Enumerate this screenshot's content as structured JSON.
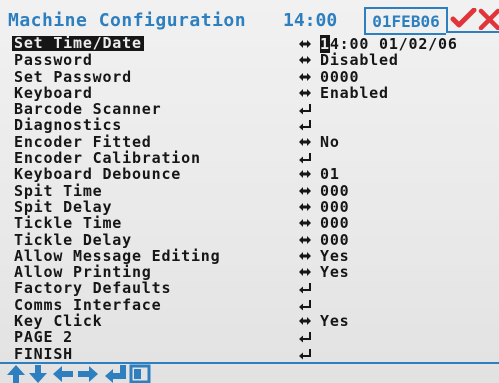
{
  "header": {
    "title": "Machine Configuration",
    "time": "14:00",
    "date": "01FEB06",
    "status_icons": [
      "tick-icon",
      "cross-icon"
    ],
    "colors": {
      "accent": "#2d7fbf",
      "tick": "#e0343a",
      "cross": "#e0343a"
    }
  },
  "menu": {
    "items": [
      {
        "label": "Set Time/Date",
        "arrow": "left-right-arrow",
        "value_cursor": "1",
        "value_rest": "4:00 01/02/06",
        "selected": true
      },
      {
        "label": "Password",
        "arrow": "left-right-arrow",
        "value": "Disabled"
      },
      {
        "label": "Set Password",
        "arrow": "left-right-arrow",
        "value": "0000"
      },
      {
        "label": "Keyboard",
        "arrow": "left-right-arrow",
        "value": "Enabled"
      },
      {
        "label": "Barcode Scanner",
        "arrow": "enter-arrow",
        "value": ""
      },
      {
        "label": "Diagnostics",
        "arrow": "enter-arrow",
        "value": ""
      },
      {
        "label": "Encoder Fitted",
        "arrow": "left-right-arrow",
        "value": "No"
      },
      {
        "label": "Encoder Calibration",
        "arrow": "enter-arrow",
        "value": ""
      },
      {
        "label": "Keyboard Debounce",
        "arrow": "left-right-arrow",
        "value": "01"
      },
      {
        "label": "Spit Time",
        "arrow": "left-right-arrow",
        "value": "000"
      },
      {
        "label": "Spit Delay",
        "arrow": "left-right-arrow",
        "value": "000"
      },
      {
        "label": "Tickle Time",
        "arrow": "left-right-arrow",
        "value": "000"
      },
      {
        "label": "Tickle Delay",
        "arrow": "left-right-arrow",
        "value": "000"
      },
      {
        "label": "Allow Message Editing",
        "arrow": "left-right-arrow",
        "value": "Yes"
      },
      {
        "label": "Allow Printing",
        "arrow": "left-right-arrow",
        "value": "Yes"
      },
      {
        "label": "Factory Defaults",
        "arrow": "enter-arrow",
        "value": ""
      },
      {
        "label": "Comms Interface",
        "arrow": "enter-arrow",
        "value": ""
      },
      {
        "label": "Key Click",
        "arrow": "left-right-arrow",
        "value": "Yes"
      },
      {
        "label": "PAGE 2",
        "arrow": "enter-arrow",
        "value": ""
      },
      {
        "label": "FINISH",
        "arrow": "enter-arrow",
        "value": ""
      }
    ]
  },
  "footer": {
    "keys": [
      "up-arrow-icon",
      "down-arrow-icon",
      "left-arrow-icon",
      "right-arrow-icon",
      "enter-icon",
      "escape-icon"
    ]
  }
}
